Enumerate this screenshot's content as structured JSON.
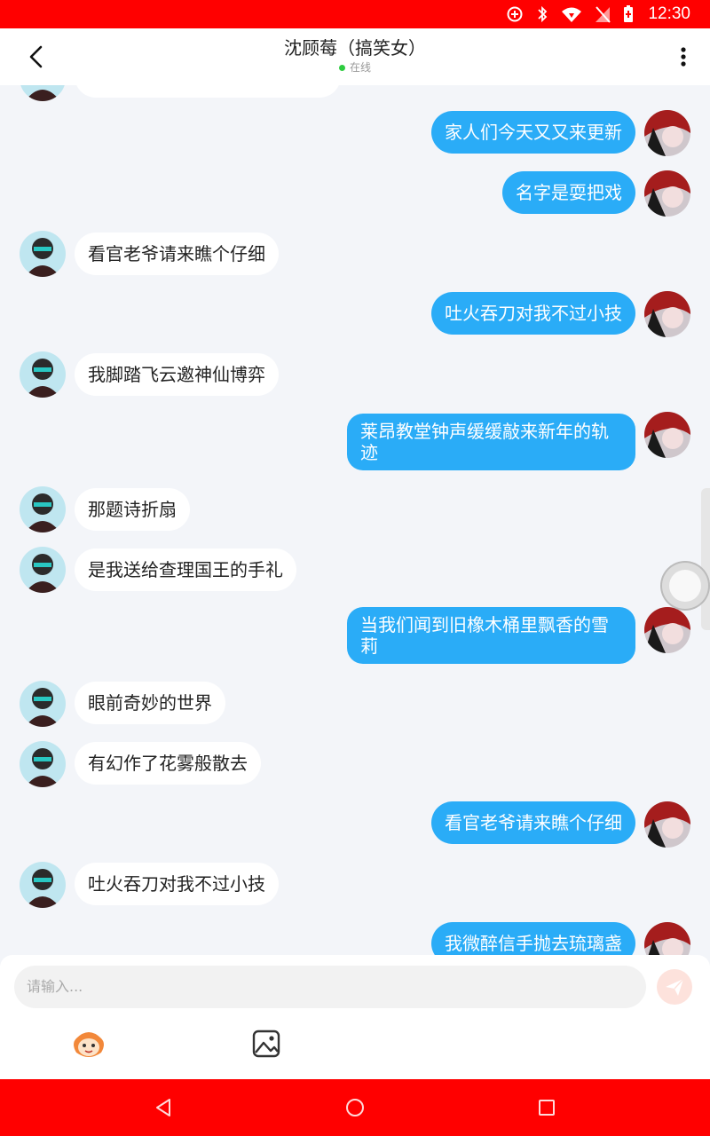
{
  "status_bar": {
    "time": "12:30",
    "color": "#ff0000"
  },
  "header": {
    "title": "沈顾莓（搞笑女）",
    "status": "在线"
  },
  "messages": [
    {
      "side": "left",
      "text": ""
    },
    {
      "side": "right",
      "text": "家人们今天又又来更新"
    },
    {
      "side": "right",
      "text": "名字是耍把戏"
    },
    {
      "side": "left",
      "text": "看官老爷请来瞧个仔细"
    },
    {
      "side": "right",
      "text": "吐火吞刀对我不过小技"
    },
    {
      "side": "left",
      "text": "我脚踏飞云邀神仙博弈"
    },
    {
      "side": "right",
      "text": "莱昂教堂钟声缓缓敲来新年的轨迹"
    },
    {
      "side": "left",
      "text": "那题诗折扇"
    },
    {
      "side": "left",
      "text": "是我送给查理国王的手礼"
    },
    {
      "side": "right",
      "text": "当我们闻到旧橡木桶里飘香的雪莉"
    },
    {
      "side": "left",
      "text": "眼前奇妙的世界"
    },
    {
      "side": "left",
      "text": "有幻作了花雾般散去"
    },
    {
      "side": "right",
      "text": "看官老爷请来瞧个仔细"
    },
    {
      "side": "left",
      "text": "吐火吞刀对我不过小技"
    },
    {
      "side": "right",
      "text": "我微醉信手抛去琉璃盏"
    }
  ],
  "input": {
    "placeholder": "请输入..."
  },
  "colors": {
    "accent": "#2aacf7",
    "left_bubble": "#ffffff",
    "system_bar": "#ff0000"
  },
  "icons": [
    "back-icon",
    "more-icon",
    "emoji-icon",
    "image-icon",
    "send-icon",
    "nav-back-icon",
    "nav-home-icon",
    "nav-recent-icon"
  ]
}
